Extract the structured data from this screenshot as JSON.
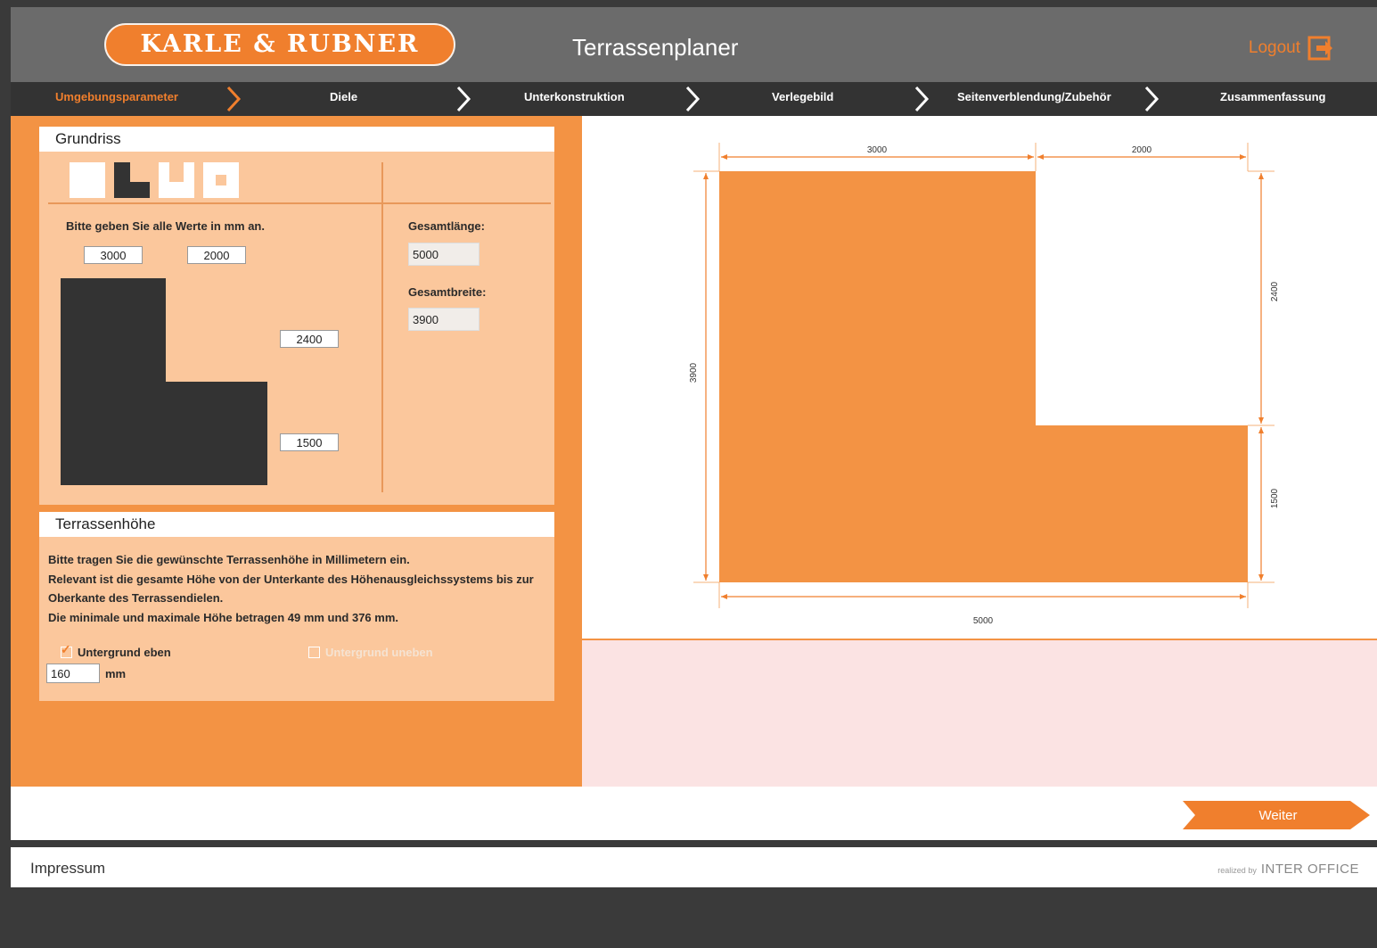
{
  "header": {
    "logo_text": "KARLE & RUBNER",
    "title": "Terrassenplaner",
    "logout_label": "Logout",
    "logout_icon": "logout-icon"
  },
  "steps": [
    {
      "label": "Umgebungsparameter",
      "active": true
    },
    {
      "label": "Diele",
      "active": false
    },
    {
      "label": "Unterkonstruktion",
      "active": false
    },
    {
      "label": "Verlegebild",
      "active": false
    },
    {
      "label": "Seitenverblendung/Zubehör",
      "active": false
    },
    {
      "label": "Zusammenfassung",
      "active": false
    }
  ],
  "grundriss": {
    "title": "Grundriss",
    "shape_options": [
      "rectangle",
      "l-shape",
      "u-shape",
      "frame"
    ],
    "selected_shape": "l-shape",
    "hint": "Bitte geben Sie alle Werte in mm an.",
    "inputs": {
      "top_left": "3000",
      "top_right": "2000",
      "right_upper": "2400",
      "right_lower": "1500"
    },
    "gesamtlaenge_label": "Gesamtlänge:",
    "gesamtlaenge": "5000",
    "gesamtbreite_label": "Gesamtbreite:",
    "gesamtbreite": "3900"
  },
  "terrassenhoehe": {
    "title": "Terrassenhöhe",
    "lines": [
      "Bitte tragen Sie die gewünschte Terrassenhöhe in Millimetern ein.",
      "Relevant ist die gesamte Höhe von der Unterkante des Höhenausgleichssystems bis zur",
      "Oberkante des Terrassendielen.",
      "Die minimale und maximale Höhe betragen 49 mm und 376 mm."
    ],
    "option_even": "Untergrund eben",
    "option_even_checked": true,
    "option_uneven": "Untergrund uneben",
    "option_uneven_checked": false,
    "height_value": "160",
    "unit": "mm"
  },
  "plan": {
    "dim_top_left": "3000",
    "dim_top_right": "2000",
    "dim_left": "3900",
    "dim_right_upper": "2400",
    "dim_right_lower": "1500",
    "dim_bottom": "5000",
    "fill_color": "#f39344"
  },
  "footer": {
    "next_label": "Weiter",
    "impressum": "Impressum",
    "powered_prefix": "realized by",
    "powered_brand": "INTER OFFICE"
  },
  "colors": {
    "accent": "#f07f2d",
    "panel": "#f39344",
    "card": "#fbc79c",
    "dark": "#333333"
  }
}
